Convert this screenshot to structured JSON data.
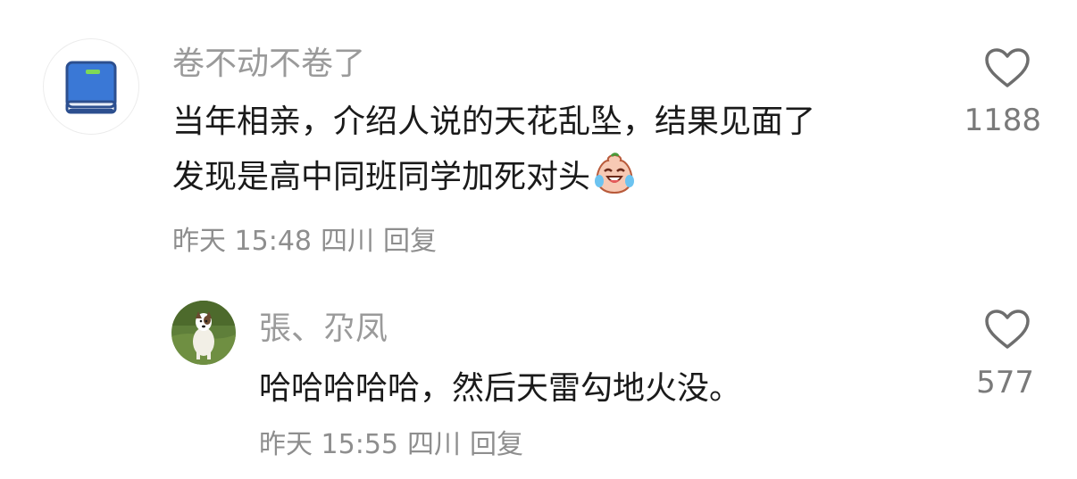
{
  "comments": [
    {
      "username": "卷不动不卷了",
      "avatar_icon": "blue-book-icon",
      "lines": [
        "当年相亲，介绍人说的天花乱坠，结果见面了",
        "发现是高中同班同学加死对头"
      ],
      "emoji": "laughing-crying-emoji",
      "time": "昨天 15:48",
      "location": "四川",
      "reply_label": "回复",
      "likes": "1188"
    },
    {
      "username": "張、尕凤",
      "avatar_icon": "dog-photo",
      "lines": [
        "哈哈哈哈哈，然后天雷勾地火没。"
      ],
      "time": "昨天 15:55",
      "location": "四川",
      "reply_label": "回复",
      "likes": "577"
    }
  ],
  "colors": {
    "text": "#1a1a1a",
    "username": "#9a9a9a",
    "meta": "#8e8e8e",
    "book_blue": "#3a78d6"
  }
}
